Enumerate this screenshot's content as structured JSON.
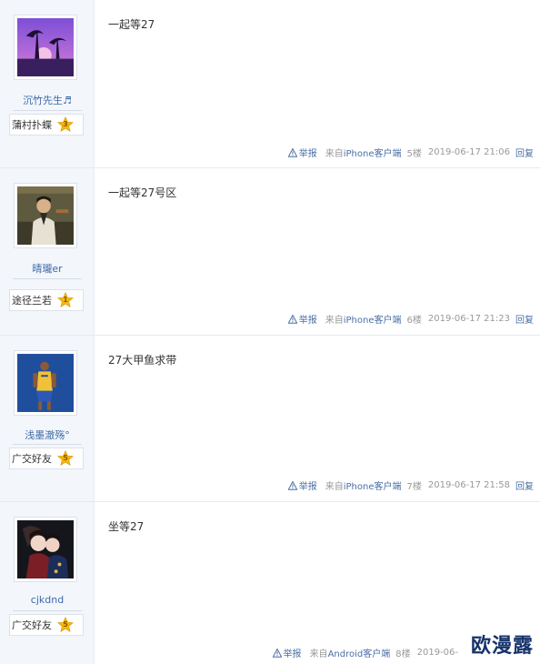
{
  "posts": [
    {
      "username": "沉竹先生♬",
      "level_title": "蒲村扑蝶",
      "level": "3",
      "content": "一起等27",
      "report_label": "举报",
      "source_prefix": "来自",
      "source_device": "iPhone客户端",
      "floor": "5楼",
      "time": "2019-06-17 21:06",
      "reply_label": "回复"
    },
    {
      "username": "晴瓏er",
      "level_title": "途径兰若",
      "level": "1",
      "content": "一起等27号区",
      "report_label": "举报",
      "source_prefix": "来自",
      "source_device": "iPhone客户端",
      "floor": "6楼",
      "time": "2019-06-17 21:23",
      "reply_label": "回复"
    },
    {
      "username": "浅墨澈殇°",
      "level_title": "广交好友",
      "level": "5",
      "content": "27大甲鱼求带",
      "report_label": "举报",
      "source_prefix": "来自",
      "source_device": "iPhone客户端",
      "floor": "7楼",
      "time": "2019-06-17 21:58",
      "reply_label": "回复"
    },
    {
      "username": "cjkdnd",
      "level_title": "广交好友",
      "level": "5",
      "content": "坐等27",
      "report_label": "举报",
      "source_prefix": "来自",
      "source_device": "Android客户端",
      "floor": "8楼",
      "time": "2019-06-",
      "reply_label": ""
    }
  ],
  "watermark": "欧漫露",
  "colors": {
    "link": "#3d6aa8",
    "meta": "#999999",
    "left_bg": "#f3f6fb",
    "badge_star": "#f5b914"
  },
  "icons": {
    "report": "warning-triangle-icon",
    "level": "star-badge-icon"
  }
}
